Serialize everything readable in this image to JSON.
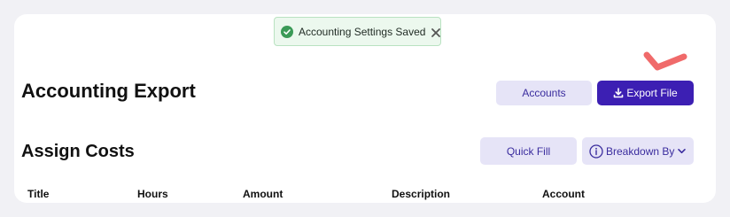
{
  "toast": {
    "message": "Accounting Settings Saved",
    "status_icon": "check-circle-icon",
    "close_icon": "close-icon",
    "color": "#3b9a57"
  },
  "page": {
    "title": "Accounting Export",
    "section_title": "Assign Costs"
  },
  "header_actions": {
    "accounts_label": "Accounts",
    "export_label": "Export File",
    "export_icon": "download-icon"
  },
  "section_actions": {
    "quick_fill_label": "Quick Fill",
    "breakdown_label": "Breakdown By",
    "breakdown_icon": "info-icon",
    "breakdown_chevron": "chevron-down-icon"
  },
  "table": {
    "columns": [
      "Title",
      "Hours",
      "Amount",
      "Description",
      "Account"
    ]
  },
  "colors": {
    "primary": "#3c1fb3",
    "secondary_bg": "#e6e4f7",
    "annotation": "#f06a6a"
  }
}
